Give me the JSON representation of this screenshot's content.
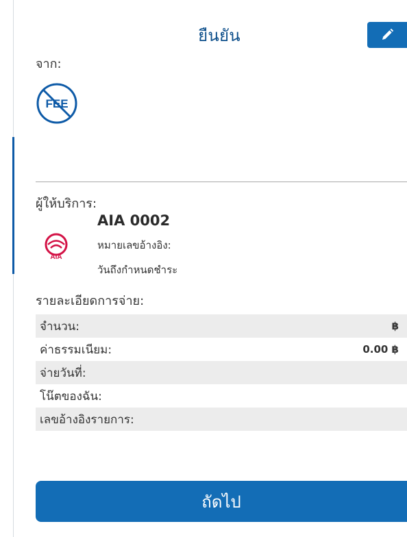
{
  "header": {
    "title": "ยืนยัน",
    "edit_icon": "pencil-icon"
  },
  "from": {
    "label": "จาก:",
    "icon": "fee-icon",
    "icon_text": "FEE"
  },
  "provider": {
    "label": "ผู้ให้บริการ:",
    "logo": "aia-logo",
    "logo_text": "AIA",
    "name": "AIA 0002",
    "reference_label": "หมายเลขอ้างอิง:",
    "due_date_label": "วันถึงกำหนดชำระ"
  },
  "payment_details": {
    "label": "รายละเอียดการจ่าย:",
    "rows": [
      {
        "label": "จำนวน:",
        "value": "฿"
      },
      {
        "label": "ค่าธรรมเนียม:",
        "value": "0.00 ฿"
      },
      {
        "label": "จ่ายวันที่:",
        "value": ""
      },
      {
        "label": "โน๊ตของฉัน:",
        "value": ""
      },
      {
        "label": "เลขอ้างอิงรายการ:",
        "value": ""
      }
    ]
  },
  "actions": {
    "next_label": "ถัดไป"
  },
  "colors": {
    "primary": "#136db6",
    "title": "#0d4f8b",
    "aia_red": "#d31145",
    "row_shade": "#ececec"
  }
}
